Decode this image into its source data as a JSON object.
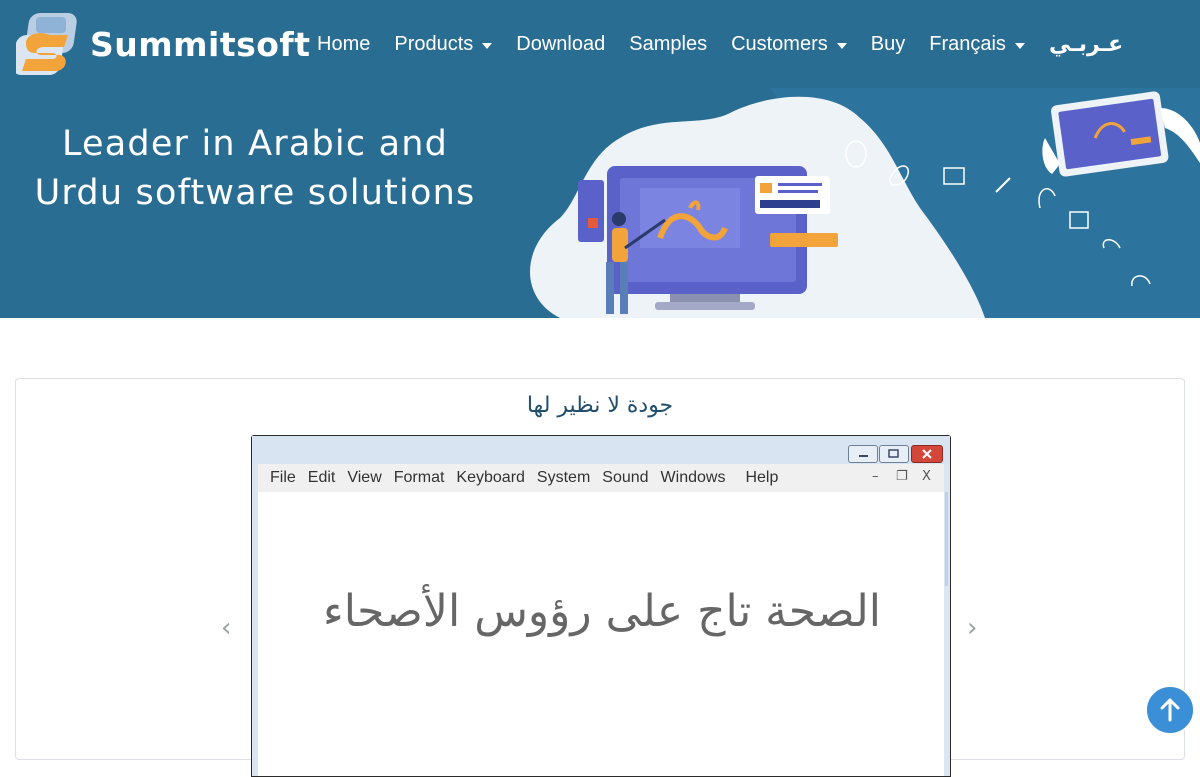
{
  "brand": {
    "name": "Summitsoft",
    "logo_icon": "summitsoft-logo-icon"
  },
  "nav": {
    "items": [
      {
        "label": "Home",
        "dropdown": false
      },
      {
        "label": "Products",
        "dropdown": true
      },
      {
        "label": "Download",
        "dropdown": false
      },
      {
        "label": "Samples",
        "dropdown": false
      },
      {
        "label": "Customers",
        "dropdown": true
      },
      {
        "label": "Buy",
        "dropdown": false
      },
      {
        "label": "Français",
        "dropdown": true
      }
    ],
    "language_label": "عـربـي"
  },
  "hero": {
    "title_line1": "Leader in Arabic and",
    "title_line2": "Urdu software solutions"
  },
  "card": {
    "title": "جودة لا نظير لها",
    "prev_arrow": "‹",
    "next_arrow": "›",
    "window": {
      "menu": [
        "File",
        "Edit",
        "View",
        "Format",
        "Keyboard",
        "System",
        "Sound",
        "Windows",
        "Help"
      ],
      "mdi_minimize": "–",
      "mdi_restore": "❐",
      "mdi_close": "X",
      "document_text": "الصحة تاج على رؤوس الأصحاء"
    }
  },
  "scroll_top": {
    "icon": "arrow-up-icon"
  },
  "colors": {
    "navbar": "#2a6d93",
    "accent_orange": "#f2a43a",
    "title_blue": "#214e6e",
    "scroll_button": "#3a8fd6"
  }
}
